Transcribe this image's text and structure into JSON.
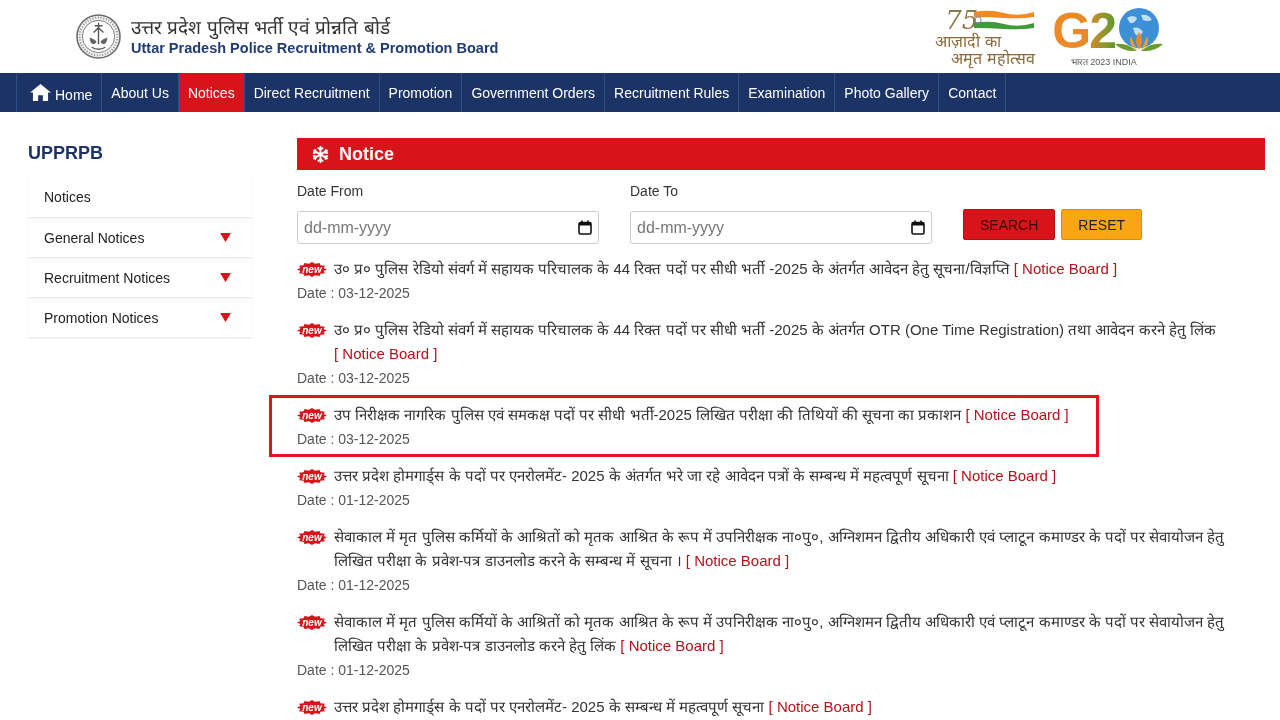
{
  "header": {
    "title_hindi": "उत्तर प्रदेश पुलिस भर्ती एवं प्रोन्नति बोर्ड",
    "title_english": "Uttar Pradesh Police Recruitment & Promotion Board",
    "jubilee_logo": {
      "number": "75",
      "line_1": "आज़ादी का",
      "line_2": "अमृत महोत्सव"
    },
    "summit_logo": {
      "mark": "G2",
      "tagline": "भारत 2023 INDIA"
    }
  },
  "nav": [
    {
      "label": "Home",
      "kind": "home",
      "selected": false
    },
    {
      "label": "About Us",
      "kind": "page",
      "selected": false
    },
    {
      "label": "Notices",
      "kind": "page",
      "selected": true
    },
    {
      "label": "Direct Recruitment",
      "kind": "page",
      "selected": false
    },
    {
      "label": "Promotion",
      "kind": "page",
      "selected": false
    },
    {
      "label": "Government Orders",
      "kind": "page",
      "selected": false
    },
    {
      "label": "Recruitment Rules",
      "kind": "page",
      "selected": false
    },
    {
      "label": "Examination",
      "kind": "page",
      "selected": false
    },
    {
      "label": "Photo Gallery",
      "kind": "page",
      "selected": false
    },
    {
      "label": "Contact",
      "kind": "page",
      "selected": false
    }
  ],
  "sidebar": {
    "title": "UPPRPB",
    "items": [
      {
        "label": "Notices",
        "has_submenu": false
      },
      {
        "label": "General Notices",
        "has_submenu": true
      },
      {
        "label": "Recruitment Notices",
        "has_submenu": true
      },
      {
        "label": "Promotion Notices",
        "has_submenu": true
      }
    ]
  },
  "notice_panel": {
    "title": "Notice",
    "filters": [
      {
        "label": "Date From",
        "placeholder": "dd-mm-yyyy"
      },
      {
        "label": "Date To",
        "placeholder": "dd-mm-yyyy"
      }
    ],
    "buttons": [
      {
        "label": "SEARCH",
        "kind": "primary"
      },
      {
        "label": "RESET",
        "kind": "secondary"
      }
    ],
    "notices": [
      {
        "badge": "new",
        "title": "उ० प्र० पुलिस रेडियो संवर्ग में सहायक परिचालक के 44 रिक्त पदों पर सीधी भर्ती -2025 के अंतर्गत आवेदन हेतु सूचना/विज्ञप्ति",
        "link": "[ Notice Board ]",
        "date": "Date : 03-12-2025",
        "highlighted": false
      },
      {
        "badge": "new",
        "title": "उ० प्र० पुलिस रेडियो संवर्ग में सहायक परिचालक के 44 रिक्त पदों पर सीधी भर्ती -2025 के अंतर्गत OTR (One Time Registration) तथा आवेदन करने हेतु लिंक",
        "link": "[ Notice Board ]",
        "date": "Date : 03-12-2025",
        "highlighted": false
      },
      {
        "badge": "new",
        "title": "उप निरीक्षक नागरिक पुलिस एवं समकक्ष पदों पर सीधी भर्ती-2025 लिखित परीक्षा की तिथियों की सूचना का प्रकाशन",
        "link": "[ Notice Board ]",
        "date": "Date : 03-12-2025",
        "highlighted": true
      },
      {
        "badge": "new",
        "title": "उत्तर प्रदेश होमगार्ड्स के पदों पर एनरोलमेंट- 2025 के अंतर्गत भरे जा रहे आवेदन पत्रों के सम्बन्ध में महत्वपूर्ण सूचना",
        "link": "[ Notice Board ]",
        "date": "Date : 01-12-2025",
        "highlighted": false
      },
      {
        "badge": "new",
        "title": "सेवाकाल में मृत पुलिस कर्मियों के आश्रितों को मृतक आश्रित के रूप में उपनिरीक्षक ना०पु०, अग्निशमन द्वितीय अधिकारी एवं प्लाटून कमाण्डर के पदों पर सेवायोजन हेतु लिखित परीक्षा के प्रवेश-पत्र डाउनलोड करने के सम्बन्ध में सूचना ।",
        "link": "[ Notice Board ]",
        "date": "Date : 01-12-2025",
        "highlighted": false
      },
      {
        "badge": "new",
        "title": "सेवाकाल में मृत पुलिस कर्मियों के आश्रितों को मृतक आश्रित के रूप में उपनिरीक्षक ना०पु०, अग्निशमन द्वितीय अधिकारी एवं प्लाटून कमाण्डर के पदों पर सेवायोजन हेतु लिखित परीक्षा के प्रवेश-पत्र डाउनलोड करने हेतु लिंक",
        "link": "[ Notice Board ]",
        "date": "Date : 01-12-2025",
        "highlighted": false
      },
      {
        "badge": "new",
        "title": "उत्तर प्रदेश होमगार्ड्स के पदों पर एनरोलमेंट- 2025 के सम्बन्ध में महत्वपूर्ण सूचना",
        "link": "[ Notice Board ]",
        "highlighted": false
      }
    ]
  }
}
